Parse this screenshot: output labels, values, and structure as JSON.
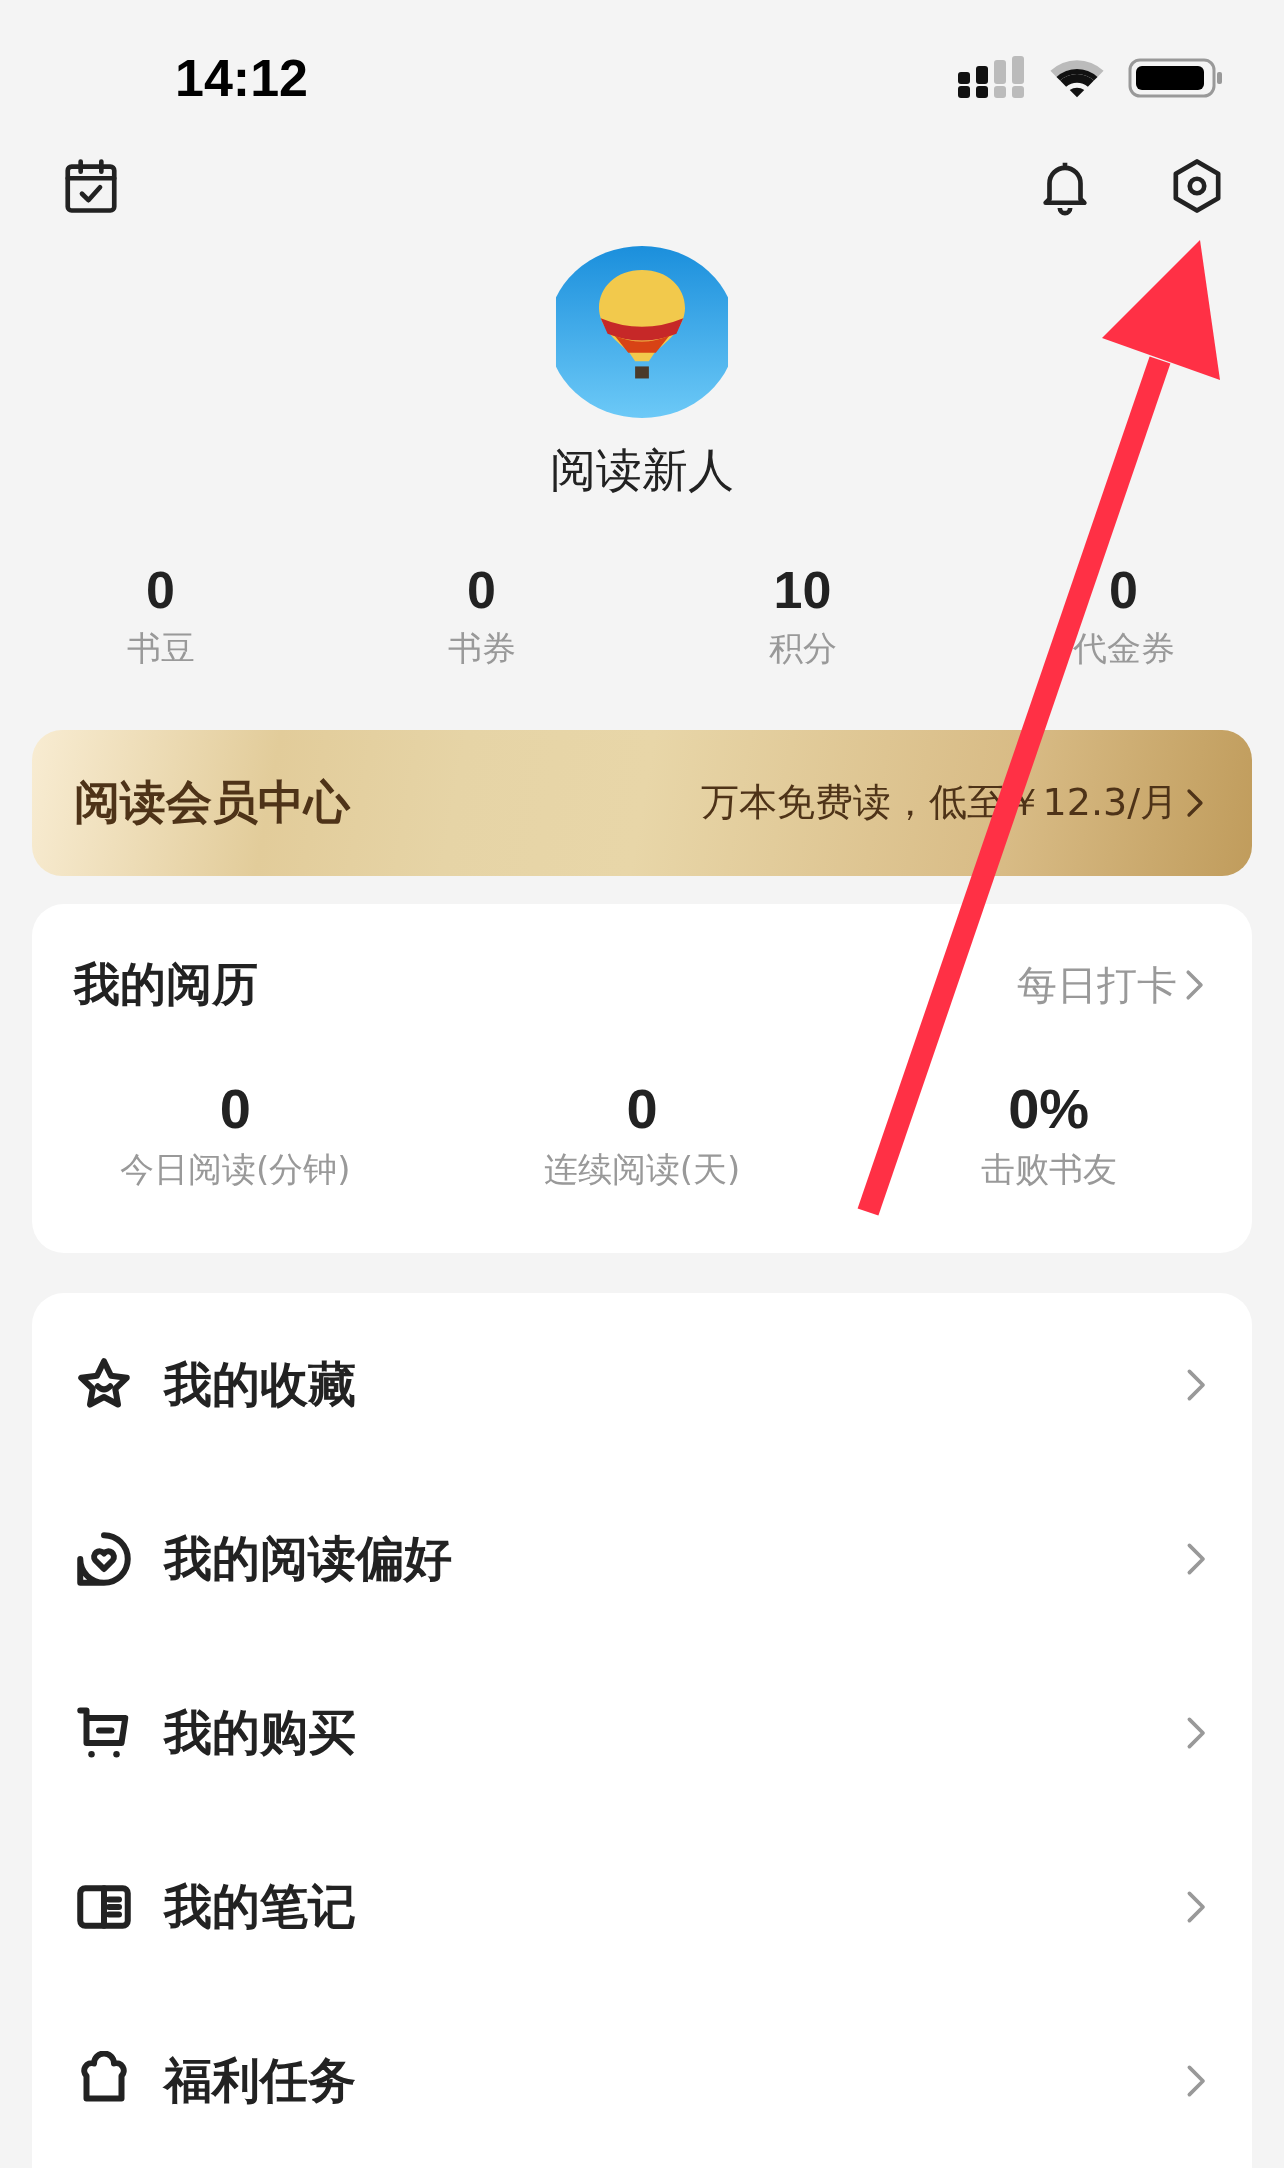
{
  "status_bar": {
    "time": "14:12"
  },
  "profile": {
    "name": "阅读新人"
  },
  "stats": [
    {
      "value": "0",
      "label": "书豆"
    },
    {
      "value": "0",
      "label": "书券"
    },
    {
      "value": "10",
      "label": "积分"
    },
    {
      "value": "0",
      "label": "代金券"
    }
  ],
  "vip_banner": {
    "title": "阅读会员中心",
    "promo": "万本免费读，低至￥12.3/月"
  },
  "reading_history": {
    "title": "我的阅历",
    "action": "每日打卡",
    "stats": [
      {
        "value": "0",
        "label": "今日阅读(分钟)"
      },
      {
        "value": "0",
        "label": "连续阅读(天)"
      },
      {
        "value": "0%",
        "label": "击败书友"
      }
    ]
  },
  "menu": [
    {
      "kind": "star",
      "label": "我的收藏"
    },
    {
      "kind": "heart",
      "label": "我的阅读偏好"
    },
    {
      "kind": "cart",
      "label": "我的购买"
    },
    {
      "kind": "notes",
      "label": "我的笔记"
    },
    {
      "kind": "gift",
      "label": "福利任务"
    }
  ]
}
